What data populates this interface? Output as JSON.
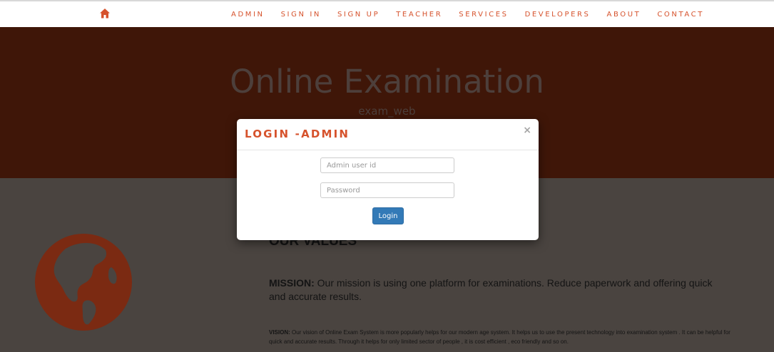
{
  "nav": {
    "home_icon": "home-icon",
    "links": [
      "ADMIN",
      "SIGN IN",
      "SIGN UP",
      "TEACHER",
      "SERVICES",
      "DEVELOPERS",
      "ABOUT",
      "CONTACT"
    ]
  },
  "hero": {
    "title": "Online Examination",
    "subtitle": "exam_web"
  },
  "content": {
    "values_heading": "OUR VALUES",
    "mission_label": "MISSION:",
    "mission_text": " Our mission is using one platform for examinations. Reduce paperwork and offering quick and accurate results.",
    "vision_label": "VISION:",
    "vision_text": " Our vision of Online Exam System is more popularly helps for our modern age system. It helps us to use the present technology into examination system . It can be helpful for quick and accurate results. Through it helps for only limited sector of people , it is cost efficient , eco friendly and so on.",
    "globe_icon": "globe-icon"
  },
  "modal": {
    "title": "LOGIN -ADMIN",
    "close": "×",
    "user_placeholder": "Admin user id",
    "password_placeholder": "Password",
    "login_label": "Login"
  },
  "colors": {
    "accent": "#d6522c",
    "hero_bg": "#3f1608",
    "overlay_bg": "#4a4440",
    "button": "#337ab7"
  }
}
